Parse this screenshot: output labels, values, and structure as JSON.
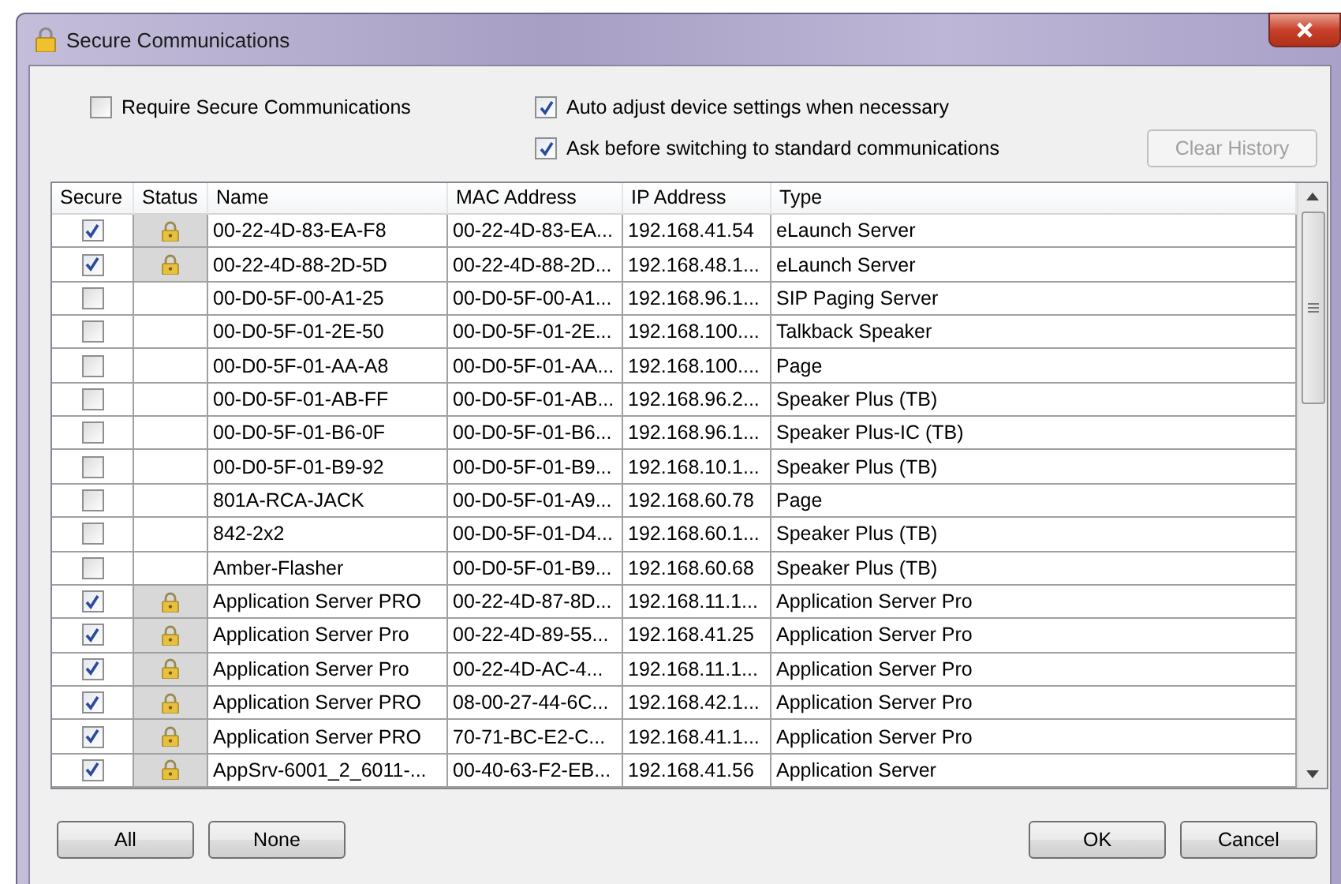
{
  "window": {
    "title": "Secure Communications"
  },
  "options": [
    {
      "label": "Require Secure Communications",
      "checked": false
    },
    {
      "label": "Auto adjust device settings when necessary",
      "checked": true
    },
    {
      "label": "Ask before switching to standard communications",
      "checked": true
    }
  ],
  "clear_history_button": {
    "label": "Clear History",
    "disabled": true
  },
  "table": {
    "columns": [
      "Secure",
      "Status",
      "Name",
      "MAC Address",
      "IP Address",
      "Type"
    ],
    "rows": [
      {
        "secure": true,
        "locked": true,
        "name": "00-22-4D-83-EA-F8",
        "mac": "00-22-4D-83-EA...",
        "ip": "192.168.41.54",
        "type": "eLaunch Server"
      },
      {
        "secure": true,
        "locked": true,
        "name": "00-22-4D-88-2D-5D",
        "mac": "00-22-4D-88-2D...",
        "ip": "192.168.48.1...",
        "type": "eLaunch Server"
      },
      {
        "secure": false,
        "locked": false,
        "name": "00-D0-5F-00-A1-25",
        "mac": "00-D0-5F-00-A1...",
        "ip": "192.168.96.1...",
        "type": "SIP Paging Server"
      },
      {
        "secure": false,
        "locked": false,
        "name": "00-D0-5F-01-2E-50",
        "mac": "00-D0-5F-01-2E...",
        "ip": "192.168.100....",
        "type": "Talkback Speaker"
      },
      {
        "secure": false,
        "locked": false,
        "name": "00-D0-5F-01-AA-A8",
        "mac": "00-D0-5F-01-AA...",
        "ip": "192.168.100....",
        "type": "Page"
      },
      {
        "secure": false,
        "locked": false,
        "name": "00-D0-5F-01-AB-FF",
        "mac": "00-D0-5F-01-AB...",
        "ip": "192.168.96.2...",
        "type": "Speaker Plus (TB)"
      },
      {
        "secure": false,
        "locked": false,
        "name": "00-D0-5F-01-B6-0F",
        "mac": "00-D0-5F-01-B6...",
        "ip": "192.168.96.1...",
        "type": "Speaker Plus-IC (TB)"
      },
      {
        "secure": false,
        "locked": false,
        "name": "00-D0-5F-01-B9-92",
        "mac": "00-D0-5F-01-B9...",
        "ip": "192.168.10.1...",
        "type": "Speaker Plus (TB)"
      },
      {
        "secure": false,
        "locked": false,
        "name": "801A-RCA-JACK",
        "mac": "00-D0-5F-01-A9...",
        "ip": "192.168.60.78",
        "type": "Page"
      },
      {
        "secure": false,
        "locked": false,
        "name": "842-2x2",
        "mac": "00-D0-5F-01-D4...",
        "ip": "192.168.60.1...",
        "type": "Speaker Plus (TB)"
      },
      {
        "secure": false,
        "locked": false,
        "name": "Amber-Flasher",
        "mac": "00-D0-5F-01-B9...",
        "ip": "192.168.60.68",
        "type": "Speaker Plus (TB)"
      },
      {
        "secure": true,
        "locked": true,
        "name": "Application Server PRO",
        "mac": "00-22-4D-87-8D...",
        "ip": "192.168.11.1...",
        "type": "Application Server Pro"
      },
      {
        "secure": true,
        "locked": true,
        "name": "Application Server Pro",
        "mac": "00-22-4D-89-55...",
        "ip": "192.168.41.25",
        "type": "Application Server Pro"
      },
      {
        "secure": true,
        "locked": true,
        "name": "Application Server Pro",
        "mac": "00-22-4D-AC-4...",
        "ip": "192.168.11.1...",
        "type": "Application Server Pro"
      },
      {
        "secure": true,
        "locked": true,
        "name": "Application Server PRO",
        "mac": "08-00-27-44-6C...",
        "ip": "192.168.42.1...",
        "type": "Application Server Pro"
      },
      {
        "secure": true,
        "locked": true,
        "name": "Application Server PRO",
        "mac": "70-71-BC-E2-C...",
        "ip": "192.168.41.1...",
        "type": "Application Server Pro"
      },
      {
        "secure": true,
        "locked": true,
        "name": "AppSrv-6001_2_6011-...",
        "mac": "00-40-63-F2-EB...",
        "ip": "192.168.41.56",
        "type": "Application Server"
      }
    ]
  },
  "buttons_left": [
    "All",
    "None"
  ],
  "buttons_right": [
    "OK",
    "Cancel"
  ]
}
